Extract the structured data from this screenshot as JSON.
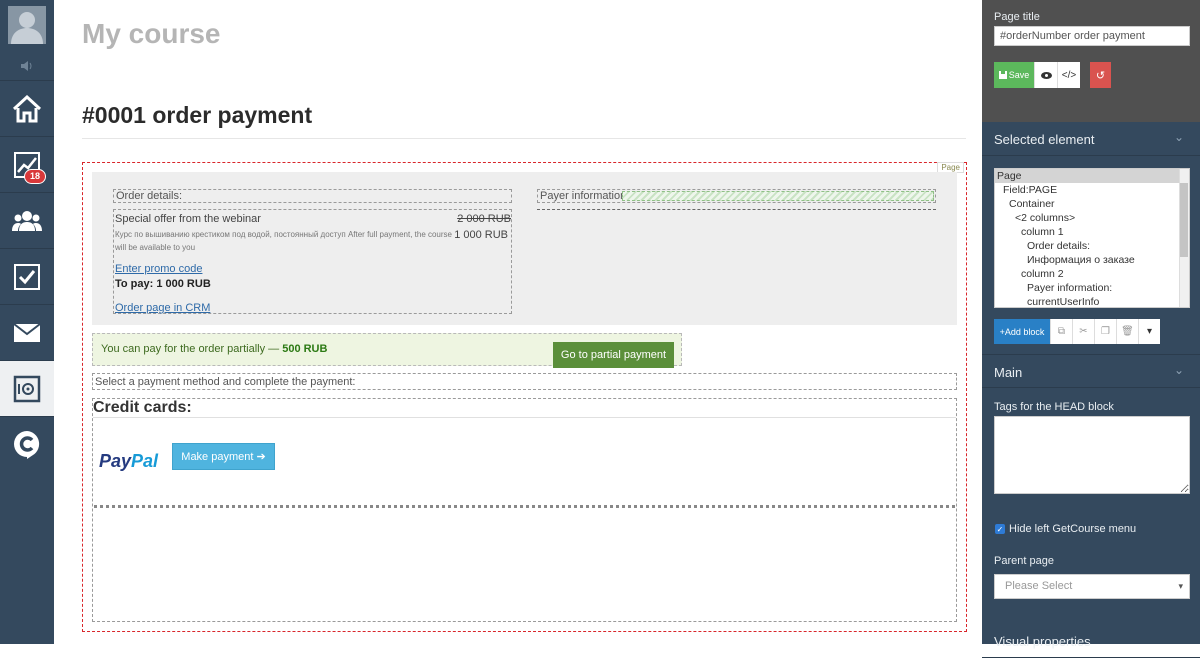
{
  "nav": {
    "badge": "18",
    "items": [
      {
        "icon": "home-icon"
      },
      {
        "icon": "chart-icon"
      },
      {
        "icon": "users-icon"
      },
      {
        "icon": "tasks-icon"
      },
      {
        "icon": "mail-icon"
      },
      {
        "icon": "safe-icon"
      },
      {
        "icon": "getcourse-logo-icon"
      }
    ]
  },
  "main": {
    "course_title": "My course",
    "order_title": "#0001 order payment",
    "page_tag": "Page",
    "order_details_label": "Order details:",
    "offer_name": "Special offer from the webinar",
    "price_old": "2 000 RUB",
    "price_new": "1 000 RUB",
    "offer_desc": "Курс по вышиванию крестиком под водой, постоянный доступ After full payment, the course will be available to you",
    "promo_link": "Enter promo code",
    "to_pay": "To pay: 1 000 RUB",
    "crm_link": "Order page in CRM",
    "payer_label": "Payer information:",
    "partial_text": "You can pay for the order partially — ",
    "partial_amount": "500 RUB",
    "partial_button": "Go to partial payment",
    "method_text": "Select a payment method and complete the payment:",
    "credit_title": "Credit cards:",
    "paypal_pay": "Pay",
    "paypal_pal": "Pal",
    "make_payment": "Make payment ➔"
  },
  "panel": {
    "page_title_label": "Page title",
    "page_title_value": "#orderNumber order payment",
    "save_label": "Save",
    "selected_element": "Selected element",
    "tree": [
      {
        "label": "Page",
        "indent": 0,
        "selected": true
      },
      {
        "label": "Field:PAGE",
        "indent": 1
      },
      {
        "label": "Container",
        "indent": 2
      },
      {
        "label": "<2 columns>",
        "indent": 3
      },
      {
        "label": "column 1",
        "indent": 4
      },
      {
        "label": "Order details:",
        "indent": 5
      },
      {
        "label": "Информация о заказе",
        "indent": 5
      },
      {
        "label": "column 2",
        "indent": 4
      },
      {
        "label": "Payer information:",
        "indent": 5
      },
      {
        "label": "currentUserInfo",
        "indent": 5
      }
    ],
    "add_block": "+Add block",
    "main_section": "Main",
    "head_tags_label": "Tags for the HEAD block",
    "hide_menu_label": "Hide left GetCourse menu",
    "hide_menu_checked": true,
    "parent_page_label": "Parent page",
    "parent_page_placeholder": "Please Select",
    "visual_properties": "Visual properties"
  },
  "colors": {
    "nav_bg": "#34495e",
    "accent_blue": "#2980c6",
    "save_green": "#5cb85c",
    "reset_red": "#d9534f",
    "partial_green": "#5b8f3a",
    "paypal_btn": "#4fb4df"
  }
}
